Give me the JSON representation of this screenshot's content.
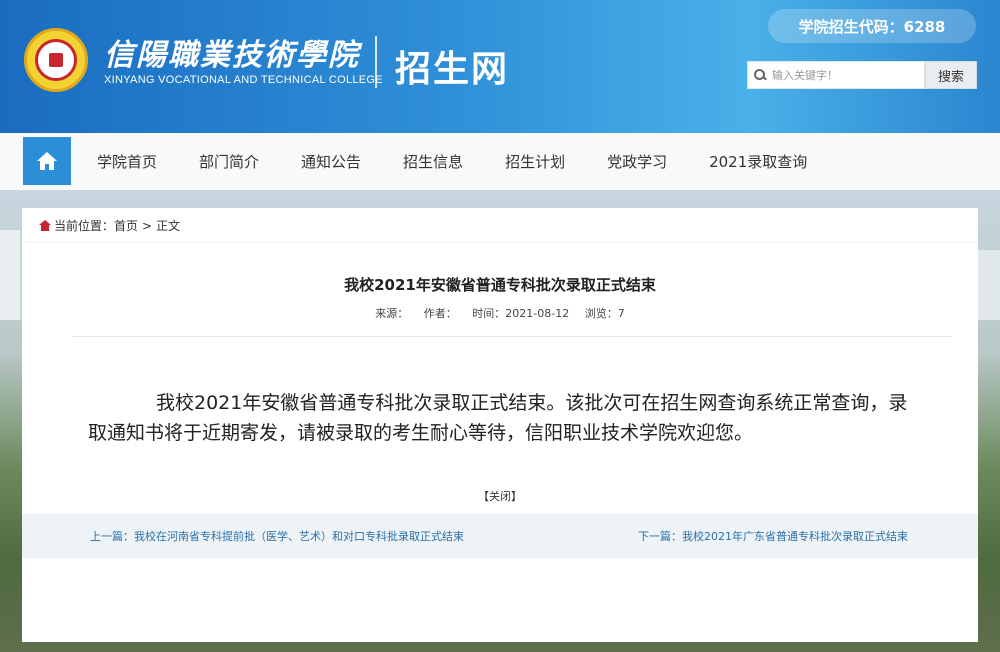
{
  "header": {
    "college_name_cn": "信陽職業技術學院",
    "college_name_en": "XINYANG VOCATIONAL AND TECHNICAL COLLEGE",
    "site_title": "招生网",
    "admission_code": "学院招生代码：6288",
    "search_placeholder": "输入关键字！",
    "search_button": "搜索"
  },
  "nav": {
    "home_icon": "home-icon",
    "items": [
      "学院首页",
      "部门简介",
      "通知公告",
      "招生信息",
      "招生计划",
      "党政学习",
      "2021录取查询"
    ]
  },
  "breadcrumb": {
    "prefix": "当前位置：",
    "home": "首页",
    "separator": ">",
    "current": "正文"
  },
  "article": {
    "title": "我校2021年安徽省普通专科批次录取正式结束",
    "source": "来源：",
    "author": "作者：",
    "time": "时间：2021-08-12",
    "views": "浏览：7",
    "body": "我校2021年安徽省普通专科批次录取正式结束。该批次可在招生网查询系统正常查询，录取通知书将于近期寄发，请被录取的考生耐心等待，信阳职业技术学院欢迎您。",
    "close": "【关闭】"
  },
  "prevnext": {
    "prev": "上一篇：我校在河南省专科提前批（医学、艺术）和对口专科批录取正式结束",
    "next": "下一篇：我校2021年广东省普通专科批次录取正式结束"
  },
  "colors": {
    "header_blue": "#2f8fd8",
    "home_button": "#2b8fd7",
    "link": "#2c6fa8"
  }
}
